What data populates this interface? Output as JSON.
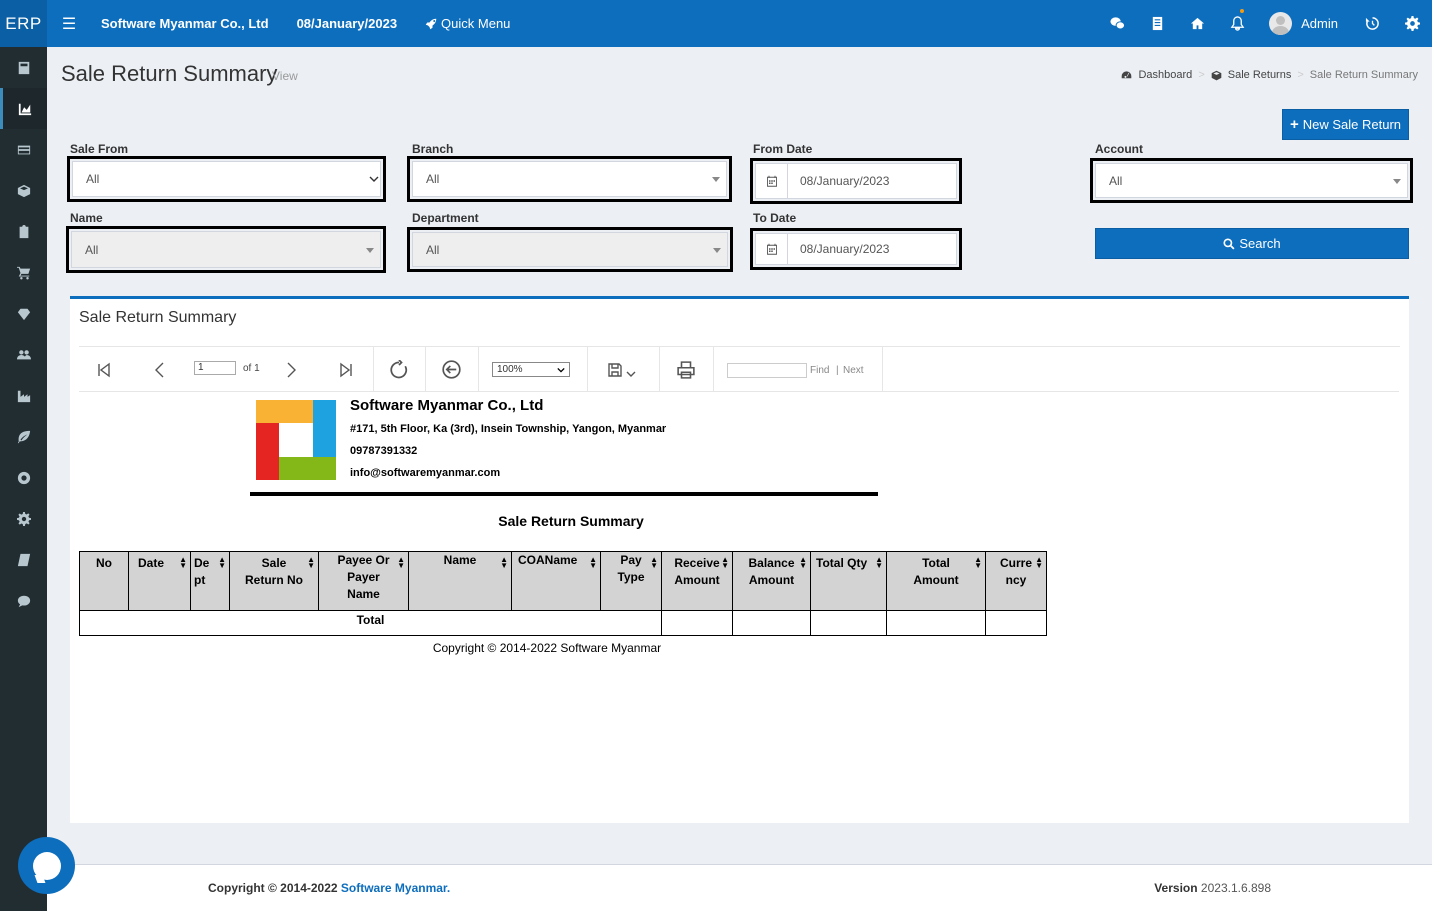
{
  "topbar": {
    "logo": "ERP",
    "company": "Software Myanmar Co., Ltd",
    "date": "08/January/2023",
    "quick_menu": "Quick Menu",
    "user": "Admin"
  },
  "page": {
    "title": "Sale Return Summary",
    "subtitle": "View",
    "breadcrumb": [
      "Dashboard",
      "Sale Returns",
      "Sale Return Summary"
    ],
    "new_button": "New Sale Return"
  },
  "filters": {
    "sale_from": {
      "label": "Sale From",
      "value": "All"
    },
    "branch": {
      "label": "Branch",
      "value": "All"
    },
    "from_date": {
      "label": "From Date",
      "value": "08/January/2023"
    },
    "account": {
      "label": "Account",
      "value": "All"
    },
    "name": {
      "label": "Name",
      "value": "All"
    },
    "department": {
      "label": "Department",
      "value": "All"
    },
    "to_date": {
      "label": "To Date",
      "value": "08/January/2023"
    },
    "search_button": "Search"
  },
  "report_box": {
    "title": "Sale Return Summary",
    "toolbar": {
      "page_value": "1",
      "page_of": "of 1",
      "zoom": "100%",
      "find": "Find",
      "next": "Next"
    },
    "company": {
      "name": "Software Myanmar Co., Ltd",
      "address": "#171, 5th Floor, Ka (3rd), Insein Township, Yangon, Myanmar",
      "phone": "09787391332",
      "email": "info@softwaremyanmar.com"
    },
    "report_title": "Sale Return Summary",
    "columns": [
      "No",
      "Date",
      "De pt",
      "Sale Return No",
      "Payee Or Payer Name",
      "Name",
      "COAName",
      "Pay Type",
      "Receive Amount",
      "Balance Amount",
      "Total Qty",
      "Total Amount",
      "Curre ncy"
    ],
    "total_label": "Total",
    "copyright": "Copyright © 2014-2022 Software Myanmar"
  },
  "footer": {
    "copyright_prefix": "Copyright © 2014-2022 ",
    "brand": "Software Myanmar.",
    "version_label": "Version",
    "version": "2023.1.6.898"
  },
  "colors": {
    "primary": "#0d6ebd",
    "sidebar": "#222d32",
    "background": "#ecf0f5"
  }
}
